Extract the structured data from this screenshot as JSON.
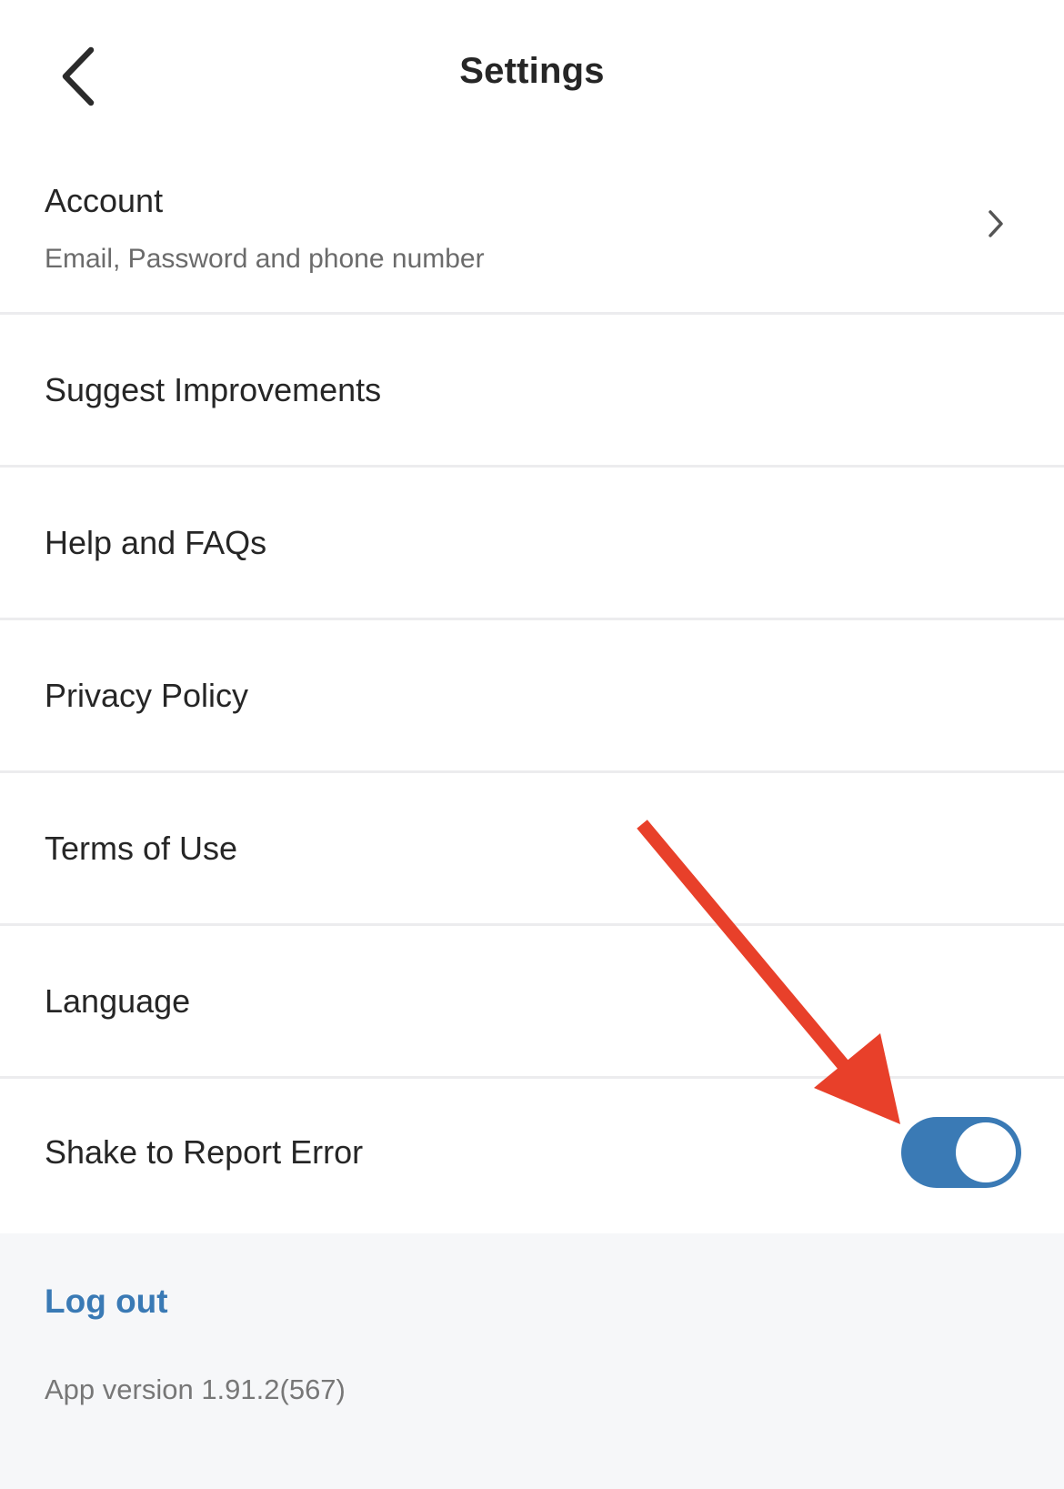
{
  "header": {
    "title": "Settings"
  },
  "settings": {
    "account": {
      "label": "Account",
      "subtitle": "Email, Password and phone number"
    },
    "items": [
      {
        "label": "Suggest Improvements"
      },
      {
        "label": "Help and FAQs"
      },
      {
        "label": "Privacy Policy"
      },
      {
        "label": "Terms of Use"
      },
      {
        "label": "Language"
      }
    ],
    "shake": {
      "label": "Shake to Report Error",
      "enabled": true
    }
  },
  "footer": {
    "logout_label": "Log out",
    "version_text": "App version 1.91.2(567)"
  },
  "colors": {
    "accent": "#3a7ab5",
    "toggle_on": "#3a7ab5",
    "annotation_arrow": "#e8402a"
  },
  "icons": {
    "back": "chevron-left-icon",
    "account_chevron": "chevron-right-icon"
  }
}
